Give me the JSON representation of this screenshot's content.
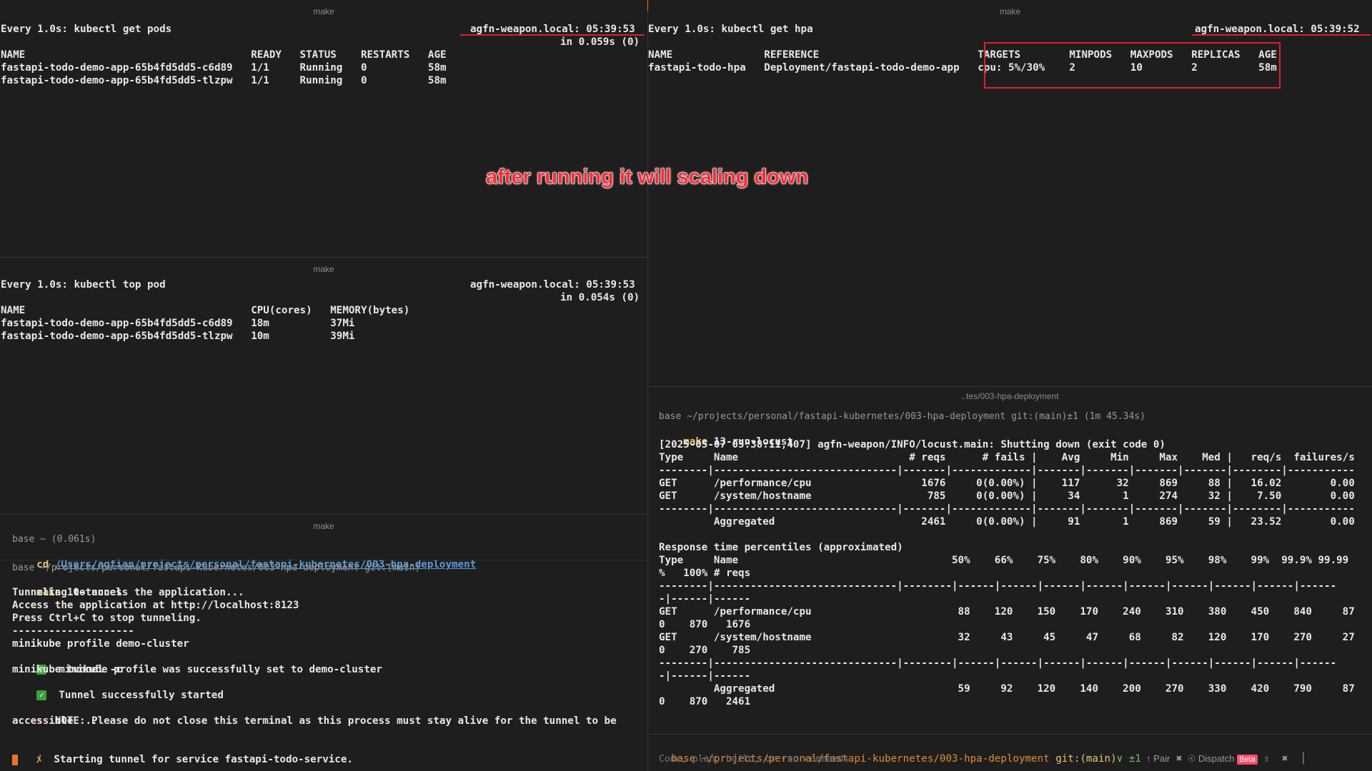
{
  "panes": {
    "top_left": {
      "title": "make",
      "watch_cmd": "Every 1.0s: kubectl get pods",
      "host_time": "agfn-weapon.local: 05:39:53",
      "duration": "in 0.059s (0)",
      "header": "NAME                                     READY   STATUS    RESTARTS   AGE",
      "rows": [
        "fastapi-todo-demo-app-65b4fd5dd5-c6d89   1/1     Running   0          58m",
        "fastapi-todo-demo-app-65b4fd5dd5-tlzpw   1/1     Running   0          58m"
      ]
    },
    "mid_left": {
      "title": "make",
      "watch_cmd": "Every 1.0s: kubectl top pod",
      "host_time": "agfn-weapon.local: 05:39:53",
      "duration": "in 0.054s (0)",
      "header": "NAME                                     CPU(cores)   MEMORY(bytes)",
      "rows": [
        "fastapi-todo-demo-app-65b4fd5dd5-c6d89   18m          37Mi",
        "fastapi-todo-demo-app-65b4fd5dd5-tlzpw   10m          39Mi"
      ]
    },
    "bottom_left": {
      "title": "make",
      "prev_prompt": "base ~ (0.061s)",
      "cd_cmd": "cd",
      "cd_path": "/Users/agfian/projects/personal/fastapi-kubernetes/003-hpa-deployment",
      "prompt": "base ~/projects/personal/fastapi-kubernetes/003-hpa-deployment git:(main)",
      "make_word": "make",
      "make_target": " 10-tunnel",
      "lines": [
        "Tunneling to access the application...",
        "Access the application at http://localhost:8123",
        "Press Ctrl+C to stop tunneling.",
        "--------------------",
        "minikube profile demo-cluster"
      ],
      "check1": "  minikube profile was successfully set to demo-cluster",
      "tunnel_cmd": "minikube tunnel -c",
      "check2": "  Tunnel successfully started",
      "note1": "  NOTE: Please do not close this terminal as this process must stay alive for the tunnel to be",
      "note2": "accessible ...",
      "starting": "  Starting tunnel for service fastapi-todo-service."
    },
    "top_right": {
      "title": "make",
      "watch_cmd": "Every 1.0s: kubectl get hpa",
      "host_time": "agfn-weapon.local: 05:39:52",
      "header": "NAME               REFERENCE                          TARGETS        MINPODS   MAXPODS   REPLICAS   AGE",
      "row": "fastapi-todo-hpa   Deployment/fastapi-todo-demo-app   cpu: 5%/30%    2         10        2          58m"
    },
    "bottom_right": {
      "title": "..tes/003-hpa-deployment",
      "prompt": "base ~/projects/personal/fastapi-kubernetes/003-hpa-deployment git:(main)±1 (1m 45.34s)",
      "make_word": "make",
      "make_target": " 13-run-locust",
      "lines": [
        "[2025-05-07 05:38:11,407] agfn-weapon/INFO/locust.main: Shutting down (exit code 0)",
        "Type     Name                            # reqs      # fails |    Avg     Min     Max    Med |   req/s  failures/s",
        "--------|------------------------------|-------|-------------|-------|-------|-------|-------|--------|-----------",
        "GET      /performance/cpu                  1676     0(0.00%) |    117      32     869     88 |   16.02        0.00",
        "GET      /system/hostname                   785     0(0.00%) |     34       1     274     32 |    7.50        0.00",
        "--------|------------------------------|-------|-------------|-------|-------|-------|-------|--------|-----------",
        "         Aggregated                        2461     0(0.00%) |     91       1     869     59 |   23.52        0.00",
        "",
        "Response time percentiles (approximated)",
        "Type     Name                                   50%    66%    75%    80%    90%    95%    98%    99%  99.9% 99.99",
        "%   100% # reqs",
        "--------|------------------------------|--------|------|------|------|------|------|------|------|------|------",
        "-|------|------",
        "GET      /performance/cpu                        88    120    150    170    240    310    380    450    840     87",
        "0    870   1676",
        "GET      /system/hostname                        32     43     45     47     68     82    120    170    270     27",
        "0    270    785",
        "--------|------------------------------|--------|------|------|------|------|------|------|------|------|------",
        "-|------|------",
        "         Aggregated                              59     92    120    140    200    270    330    420    790     87",
        "0    870   2461"
      ],
      "status": {
        "base": "base",
        "path": " ~/projects/personal/fastapi-kubernetes/003-hpa-deployment",
        "git": " git:(main)",
        "dirty": "∨ ±1",
        "pair": "  ↑ Pair",
        "x1": " ✖",
        "dispatch": "  ☉ Dispatch ",
        "beta": "Beta",
        "tail": " ⇧  ✖  │",
        "placeholder": "Code, plan, build, or run commands"
      }
    }
  },
  "annotation": "after running it will scaling down"
}
